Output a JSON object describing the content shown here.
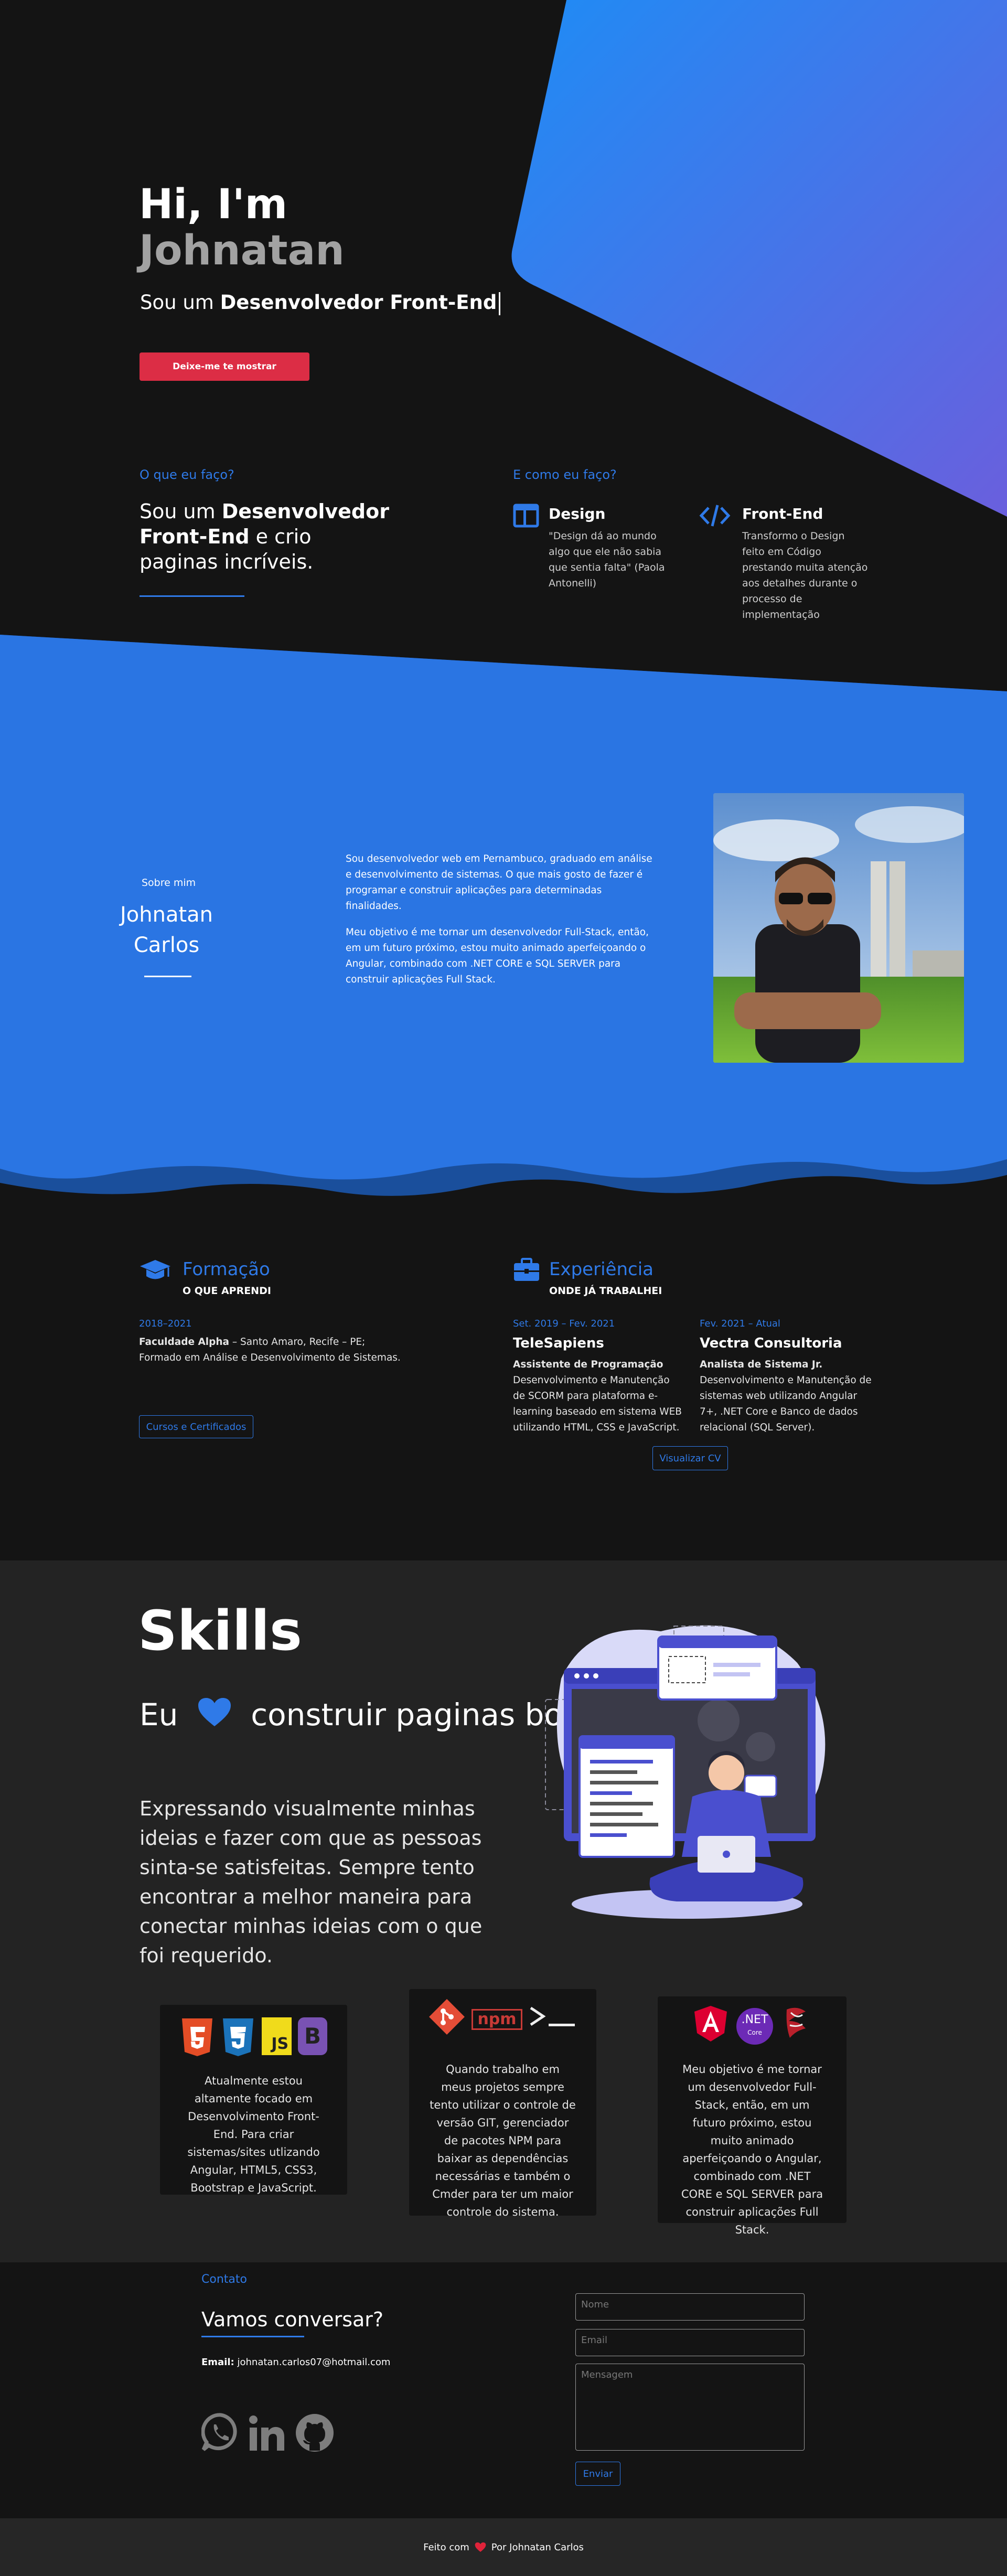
{
  "hero": {
    "greeting": "Hi, I'm",
    "name": "Johnatan",
    "subtitle_prefix": "Sou um ",
    "subtitle_bold": "Desenvolvedor Front-End",
    "cta": "Deixe-me te mostrar"
  },
  "what": {
    "label": "O que eu faço?",
    "title_prefix": "Sou um ",
    "title_bold": "Desenvolvedor Front-End",
    "title_suffix": " e crio paginas incríveis."
  },
  "how": {
    "label": "E como eu faço?",
    "services": [
      {
        "icon": "layout-icon",
        "title": "Design",
        "text": "\"Design dá ao mundo algo que ele não sabia que sentia falta\" (Paola Antonelli)"
      },
      {
        "icon": "code-icon",
        "title": "Front-End",
        "text": "Transformo o Design feito em Código prestando muita atenção aos detalhes durante o processo de implementação"
      }
    ]
  },
  "about": {
    "small": "Sobre mim",
    "name": "Johnatan Carlos",
    "p1": "Sou desenvolvedor web em Pernambuco, graduado em análise e desenvolvimento de sistemas. O que mais gosto de fazer é programar e construir aplicações para determinadas finalidades.",
    "p2": "Meu objetivo é me tornar um desenvolvedor Full-Stack, então, em um futuro próximo, estou muito animado aperfeiçoando o Angular, combinado com .NET CORE e SQL SERVER para construir aplicações Full Stack."
  },
  "education": {
    "title": "Formação",
    "subtitle": "O QUE APRENDI",
    "date": "2018–2021",
    "school": "Faculdade Alpha",
    "detail": " – Santo Amaro, Recife – PE; Formado em Análise e Desenvolvimento de Sistemas.",
    "button": "Cursos e Certificados"
  },
  "experience": {
    "title": "Experiência",
    "subtitle": "ONDE JÁ TRABALHEI",
    "jobs": [
      {
        "date": "Set. 2019 – Fev. 2021",
        "company": "TeleSapiens",
        "role": "Assistente de Programação",
        "text": "Desenvolvimento e Manutenção de SCORM para plataforma e-learning baseado em sistema WEB utilizando HTML, CSS e JavaScript."
      },
      {
        "date": "Fev. 2021 – Atual",
        "company": "Vectra Consultoria",
        "role": "Analista de Sistema Jr.",
        "text": "Desenvolvimento e Manutenção de sistemas web utilizando Angular 7+, .NET Core e Banco de dados relacional (SQL Server)."
      }
    ],
    "button": "Visualizar CV"
  },
  "skills": {
    "title": "Skills",
    "love_prefix": "Eu",
    "love_suffix": "construir paginas bonitas",
    "desc": "Expressando visualmente minhas ideias e fazer com que as pessoas sinta-se satisfeitas. Sempre tento encontrar a melhor maneira para conectar minhas ideias com o que foi requerido.",
    "cards": [
      {
        "badges": [
          "html5-icon",
          "css3-icon",
          "js-icon",
          "bootstrap-icon"
        ],
        "text": "Atualmente estou altamente focado em Desenvolvimento Front-End. Para criar sistemas/sites utlizando Angular, HTML5, CSS3, Bootstrap e JavaScript."
      },
      {
        "badges": [
          "git-icon",
          "npm-icon",
          "terminal-icon"
        ],
        "text": "Quando trabalho em meus projetos sempre tento utilizar o controle de versão GIT, gerenciador de pacotes NPM para baixar as dependências necessárias e também o Cmder para ter um maior controle do sistema."
      },
      {
        "badges": [
          "angular-icon",
          "dotnet-icon",
          "sqlserver-icon"
        ],
        "text": "Meu objetivo é me tornar um desenvolvedor Full-Stack, então, em um futuro próximo, estou muito animado aperfeiçoando o Angular, combinado com .NET CORE e SQL SERVER para construir aplicações Full Stack."
      }
    ],
    "badge_labels": {
      "js": "JS",
      "b": "B",
      "npm": "npm",
      "net": ".NET",
      "core": "Core"
    }
  },
  "contact": {
    "label": "Contato",
    "title": "Vamos conversar?",
    "email_label": "Email:",
    "email": "johnatan.carlos07@hotmail.com",
    "name_placeholder": "Nome",
    "email_placeholder": "Email",
    "message_placeholder": "Mensagem",
    "send": "Enviar"
  },
  "footer": {
    "prefix": "Feito com",
    "suffix": "Por Johnatan Carlos"
  },
  "colors": {
    "accent": "#2f7ae8",
    "cta": "#dc2d45",
    "heart": "#e0233a",
    "bg": "#141414"
  }
}
